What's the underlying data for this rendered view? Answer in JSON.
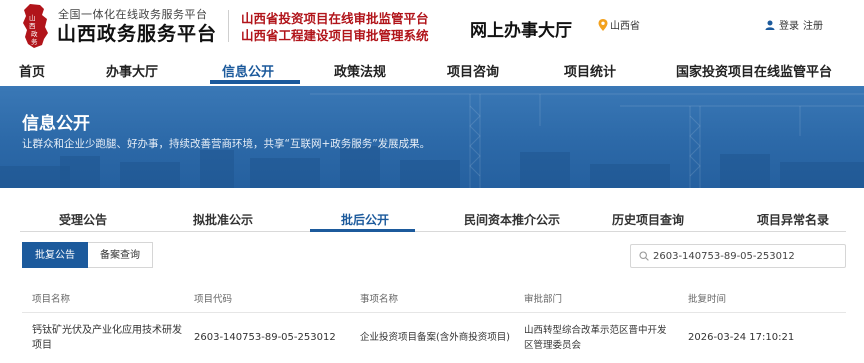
{
  "header": {
    "brand_small": "全国一体化在线政务服务平台",
    "brand_big": "山西政务服务平台",
    "logo_text": "山西政务",
    "project_line1": "山西省投资项目在线审批监管平台",
    "project_line2": "山西省工程建设项目审批管理系统",
    "hall_title": "网上办事大厅",
    "location": "山西省",
    "login": "登录",
    "register": "注册",
    "colors": {
      "accent_red": "#b1141a",
      "primary_blue": "#1c5a9c"
    }
  },
  "nav": {
    "items": [
      {
        "label": "首页"
      },
      {
        "label": "办事大厅"
      },
      {
        "label": "信息公开",
        "active": true
      },
      {
        "label": "政策法规"
      },
      {
        "label": "项目咨询"
      },
      {
        "label": "项目统计"
      },
      {
        "label": "国家投资项目在线监管平台"
      }
    ]
  },
  "banner": {
    "title": "信息公开",
    "subtitle": "让群众和企业少跑腿、好办事，持续改善营商环境，共享“互联网+政务服务”发展成果。"
  },
  "subtabs": [
    {
      "label": "受理公告"
    },
    {
      "label": "拟批准公示"
    },
    {
      "label": "批后公开",
      "active": true
    },
    {
      "label": "民间资本推介公示"
    },
    {
      "label": "历史项目查询"
    },
    {
      "label": "项目异常名录"
    }
  ],
  "filters": {
    "buttons": [
      {
        "label": "批复公告",
        "active": true
      },
      {
        "label": "备案查询"
      }
    ],
    "search_value": "2603-140753-89-05-253012",
    "search_icon": "search-icon"
  },
  "table": {
    "columns": [
      "项目名称",
      "项目代码",
      "事项名称",
      "审批部门",
      "批复时间"
    ],
    "rows": [
      {
        "name": "钙钛矿光伏及产业化应用技术研发项目",
        "code": "2603-140753-89-05-253012",
        "item": "企业投资项目备案(含外商投资项目)",
        "dept": "山西转型综合改革示范区晋中开发区管理委员会",
        "time": "2026-03-24 17:10:21"
      }
    ]
  }
}
